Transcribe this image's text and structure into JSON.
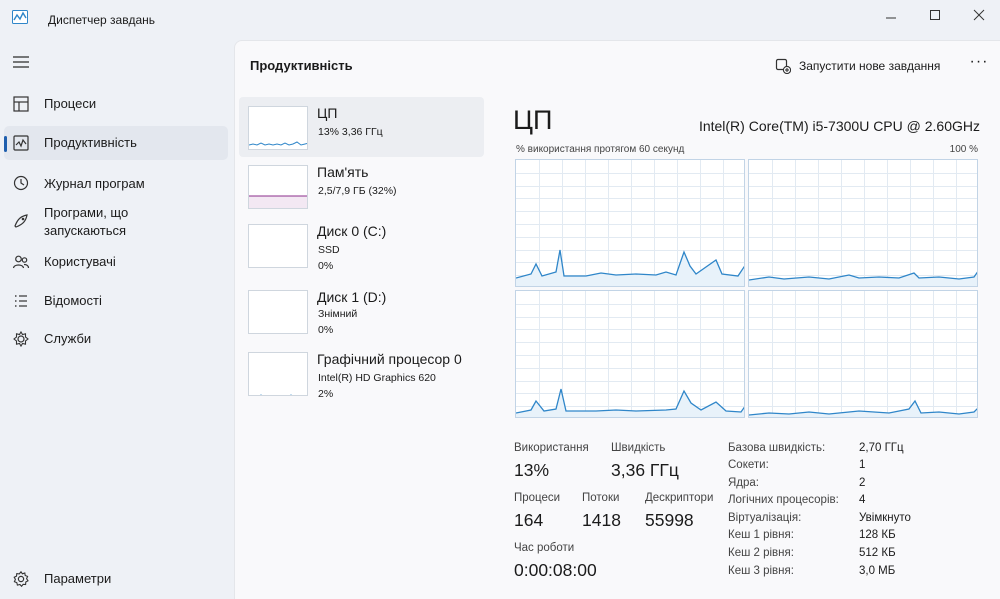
{
  "window": {
    "title": "Диспетчер завдань"
  },
  "nav": {
    "items": [
      {
        "label": "Процеси",
        "icon": "processes-icon"
      },
      {
        "label": "Продуктивність",
        "icon": "performance-icon",
        "active": true
      },
      {
        "label": "Журнал програм",
        "icon": "app-history-icon"
      },
      {
        "label": "Програми, що запускаються",
        "icon": "startup-apps-icon"
      },
      {
        "label": "Користувачі",
        "icon": "users-icon"
      },
      {
        "label": "Відомості",
        "icon": "details-icon"
      },
      {
        "label": "Служби",
        "icon": "services-icon"
      }
    ],
    "settings_label": "Параметри"
  },
  "header": {
    "title": "Продуктивність",
    "run_task_label": "Запустити нове завдання"
  },
  "resources": [
    {
      "name": "ЦП",
      "sub1": "13% 3,36 ГГц",
      "sub2": ""
    },
    {
      "name": "Пам'ять",
      "sub1": "2,5/7,9 ГБ (32%)",
      "sub2": ""
    },
    {
      "name": "Диск 0 (C:)",
      "sub1": "SSD",
      "sub2": "0%"
    },
    {
      "name": "Диск 1 (D:)",
      "sub1": "Знімний",
      "sub2": "0%"
    },
    {
      "name": "Графічний процесор 0",
      "sub1": "Intel(R) HD Graphics 620",
      "sub2": "2%"
    }
  ],
  "cpu": {
    "title": "ЦП",
    "model": "Intel(R) Core(TM) i5-7300U CPU @ 2.60GHz",
    "graph_caption": "% використання протягом 60 секунд",
    "graph_max": "100 %",
    "stats": {
      "usage_label": "Використання",
      "usage_value": "13%",
      "speed_label": "Швидкість",
      "speed_value": "3,36 ГГц",
      "processes_label": "Процеси",
      "processes_value": "164",
      "threads_label": "Потоки",
      "threads_value": "1418",
      "handles_label": "Дескриптори",
      "handles_value": "55998",
      "uptime_label": "Час роботи",
      "uptime_value": "0:00:08:00"
    },
    "details": [
      {
        "label": "Базова швидкість:",
        "value": "2,70 ГГц"
      },
      {
        "label": "Сокети:",
        "value": "1"
      },
      {
        "label": "Ядра:",
        "value": "2"
      },
      {
        "label": "Логічних процесорів:",
        "value": "4"
      },
      {
        "label": "Віртуалізація:",
        "value": "Увімкнуто"
      },
      {
        "label": "Кеш 1 рівня:",
        "value": "128 КБ"
      },
      {
        "label": "Кеш 2 рівня:",
        "value": "512 КБ"
      },
      {
        "label": "Кеш 3 рівня:",
        "value": "3,0 МБ"
      }
    ]
  },
  "colors": {
    "accent": "#1f5fae",
    "cpu_line": "#2f86c9",
    "memory_line": "#8b2e8b",
    "graph_border": "#c2d4e6"
  }
}
